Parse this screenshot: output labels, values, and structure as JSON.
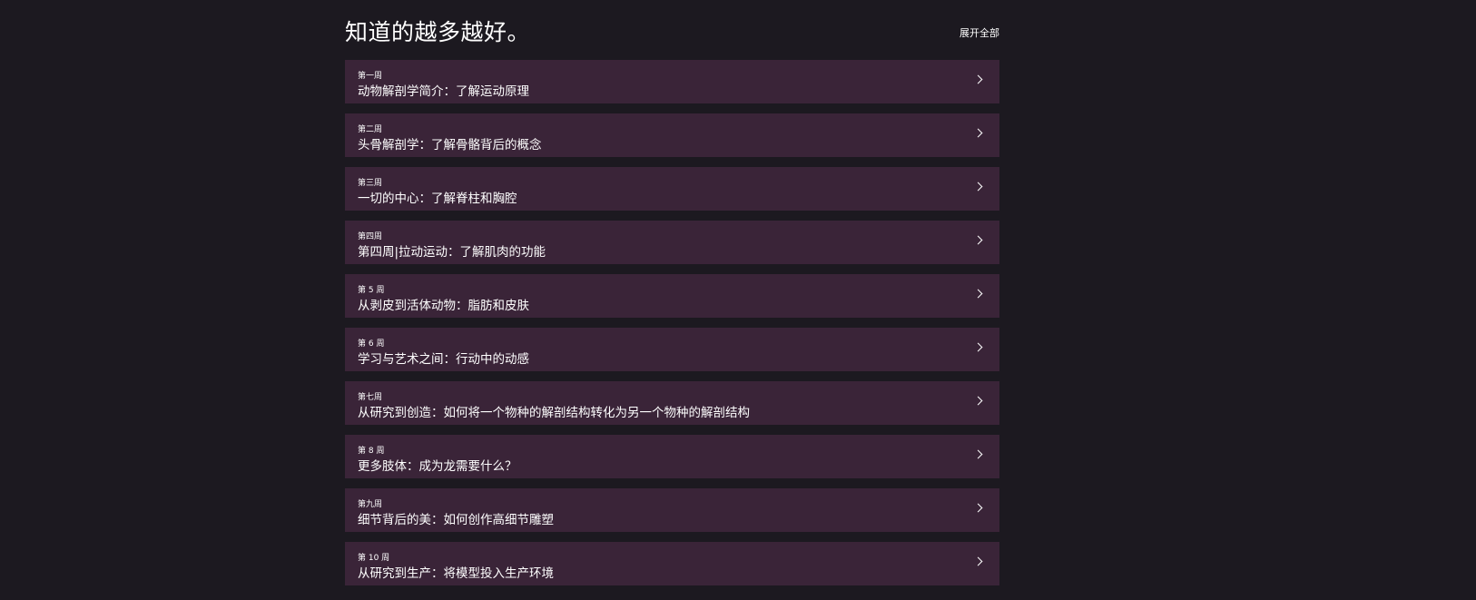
{
  "header": {
    "title": "知道的越多越好。",
    "expand_all_label": "展开全部"
  },
  "weeks": [
    {
      "label": "第一周",
      "title": "动物解剖学简介：了解运动原理"
    },
    {
      "label": "第二周",
      "title": "头骨解剖学：了解骨骼背后的概念"
    },
    {
      "label": "第三周",
      "title": "一切的中心：了解脊柱和胸腔"
    },
    {
      "label": "第四周",
      "title": "第四周|拉动运动：了解肌肉的功能"
    },
    {
      "label": "第 5 周",
      "title": "从剥皮到活体动物：脂肪和皮肤"
    },
    {
      "label": "第 6 周",
      "title": "学习与艺术之间：行动中的动感"
    },
    {
      "label": "第七周",
      "title": "从研究到创造：如何将一个物种的解剖结构转化为另一个物种的解剖结构"
    },
    {
      "label": "第 8 周",
      "title": "更多肢体：成为龙需要什么？"
    },
    {
      "label": "第九周",
      "title": "细节背后的美：如何创作高细节雕塑"
    },
    {
      "label": "第 10 周",
      "title": "从研究到生产：将模型投入生产环境"
    }
  ],
  "icons": {
    "row_action": "chevron-right-icon"
  },
  "colors": {
    "background": "#1c1920",
    "row_background": "#3a2438",
    "text": "#ffffff"
  }
}
